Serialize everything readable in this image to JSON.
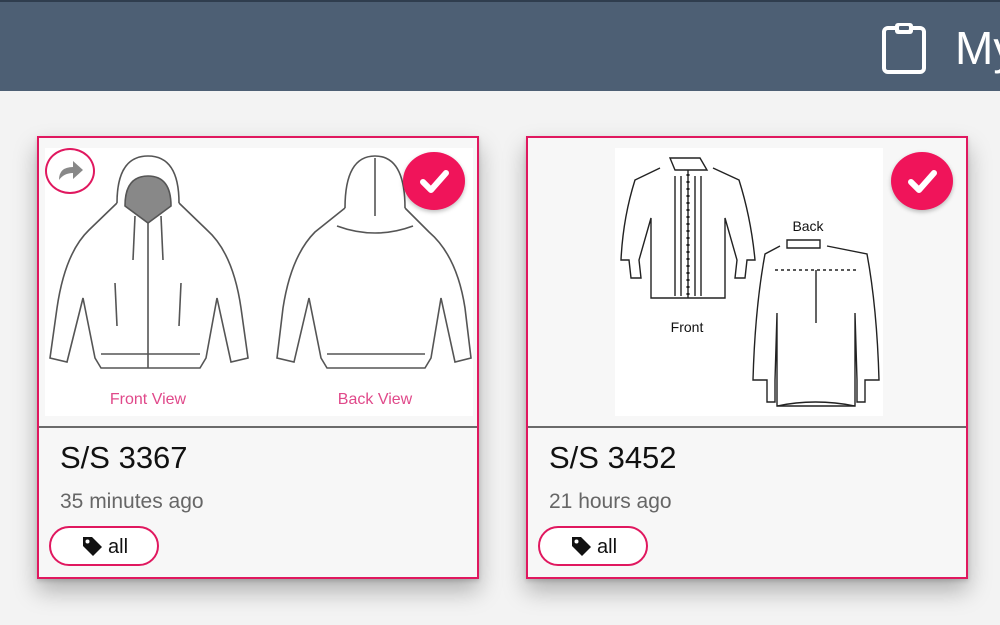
{
  "header": {
    "title": "My",
    "icon": "clipboard-icon"
  },
  "cards": [
    {
      "name": "S/S 3367",
      "time": "35 minutes ago",
      "tag": "all",
      "image_labels": {
        "front": "Front View",
        "back": "Back View"
      },
      "selected": true
    },
    {
      "name": "S/S 3452",
      "time": "21 hours ago",
      "tag": "all",
      "image_labels": {
        "front": "Front",
        "back": "Back"
      },
      "selected": true
    }
  ],
  "colors": {
    "header_bg": "#4d5f74",
    "accent": "#e0185f",
    "page_bg": "#f3f3f3"
  }
}
